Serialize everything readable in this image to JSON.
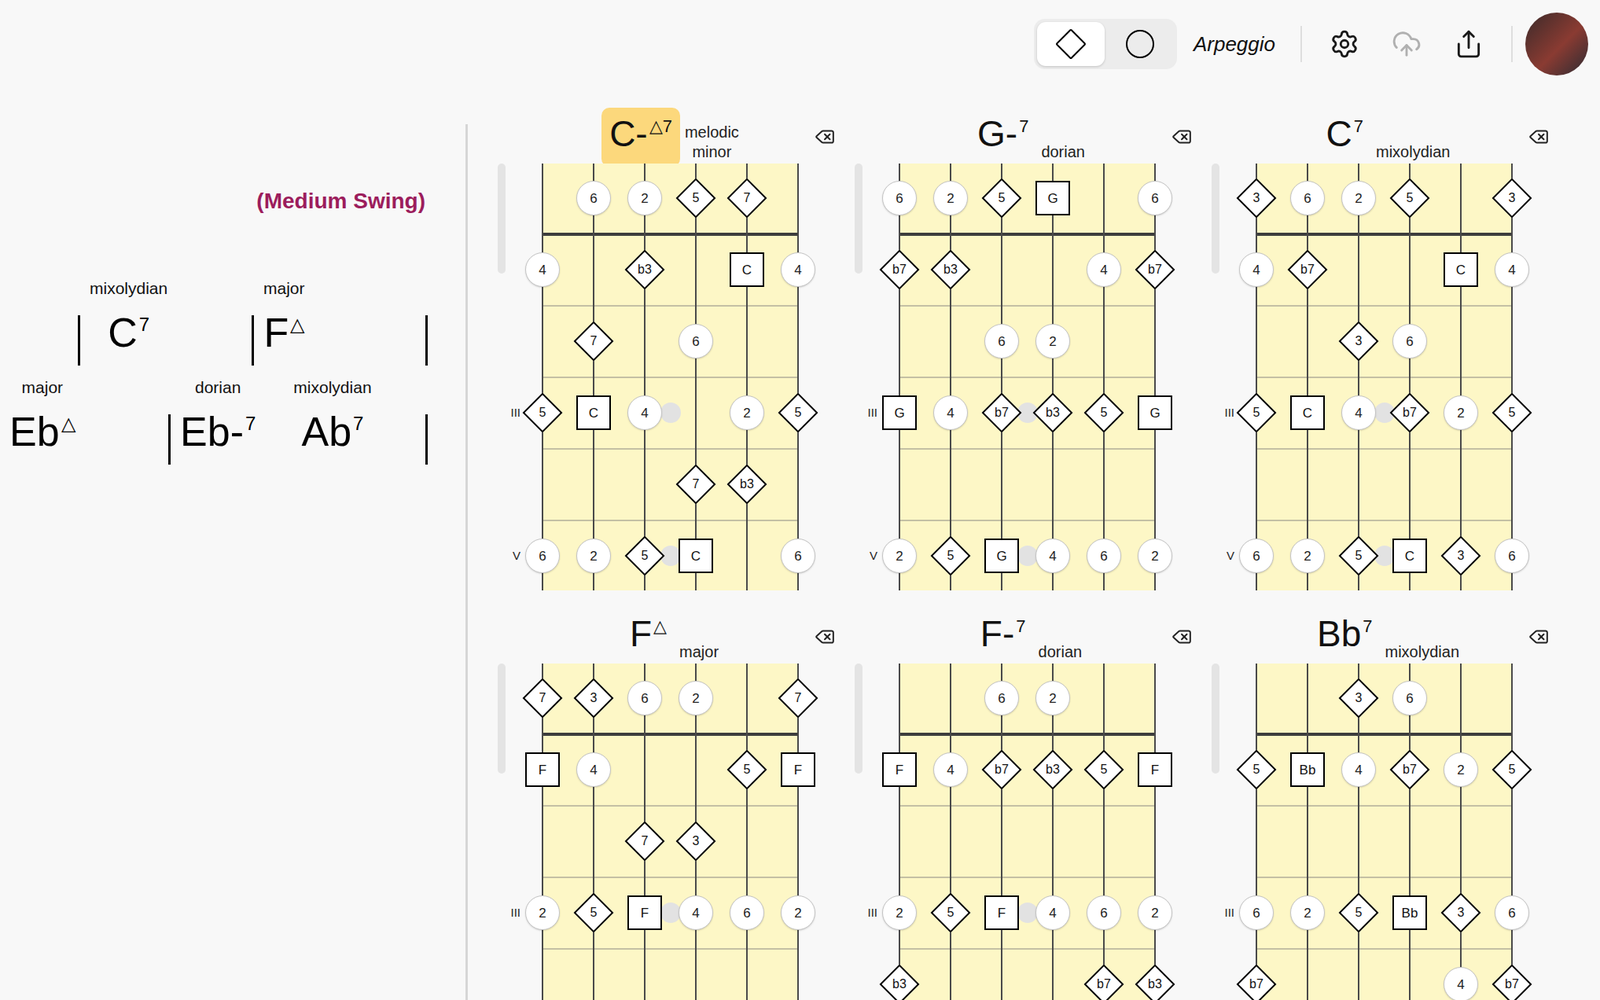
{
  "toolbar": {
    "shape_toggle": [
      {
        "kind": "diamond",
        "selected": true
      },
      {
        "kind": "circle",
        "selected": false
      }
    ],
    "mode": "Arpeggio",
    "buttons": [
      {
        "kind": "settings",
        "disabled": false
      },
      {
        "kind": "upload",
        "disabled": true
      },
      {
        "kind": "share",
        "disabled": false
      }
    ]
  },
  "chart": {
    "style": "(Medium Swing)",
    "rows": [
      {
        "barline_start": true,
        "measures": [
          {
            "chords": [
              {
                "scale": "mixolydian",
                "root": "C",
                "quality": "",
                "ext": "7"
              }
            ]
          },
          {
            "chords": [
              {
                "scale": "major",
                "root": "F",
                "quality": "",
                "ext": "△"
              }
            ]
          }
        ]
      },
      {
        "barline_start": false,
        "measures": [
          {
            "chords": [
              {
                "scale": "major",
                "root": "Eb",
                "quality": "",
                "ext": "△"
              }
            ]
          },
          {
            "chords": [
              {
                "scale": "dorian",
                "root": "Eb",
                "quality": "-",
                "ext": "7"
              },
              {
                "scale": "mixolydian",
                "root": "Ab",
                "quality": "",
                "ext": "7"
              }
            ]
          }
        ]
      }
    ]
  },
  "diagrams": [
    {
      "chord": {
        "root": "C",
        "quality": "-",
        "ext": "△7"
      },
      "scale": "melodic minor",
      "selected": true,
      "fret_labels": [
        {
          "row": 3,
          "text": "III"
        },
        {
          "row": 5,
          "text": "V"
        }
      ],
      "slides": [
        {
          "string": 2,
          "row": 3
        },
        {
          "string": 2,
          "row": 5
        }
      ],
      "markers": [
        {
          "string": 1,
          "row": 0,
          "kind": "circle",
          "label": "6"
        },
        {
          "string": 2,
          "row": 0,
          "kind": "circle",
          "label": "2"
        },
        {
          "string": 3,
          "row": 0,
          "kind": "diamond",
          "label": "5"
        },
        {
          "string": 4,
          "row": 0,
          "kind": "diamond",
          "label": "7"
        },
        {
          "string": 0,
          "row": 1,
          "kind": "circle",
          "label": "4"
        },
        {
          "string": 2,
          "row": 1,
          "kind": "diamond",
          "label": "b3"
        },
        {
          "string": 4,
          "row": 1,
          "kind": "square",
          "label": "C"
        },
        {
          "string": 5,
          "row": 1,
          "kind": "circle",
          "label": "4"
        },
        {
          "string": 1,
          "row": 2,
          "kind": "diamond",
          "label": "7"
        },
        {
          "string": 3,
          "row": 2,
          "kind": "circle",
          "label": "6"
        },
        {
          "string": 0,
          "row": 3,
          "kind": "diamond",
          "label": "5"
        },
        {
          "string": 1,
          "row": 3,
          "kind": "square",
          "label": "C"
        },
        {
          "string": 2,
          "row": 3,
          "kind": "circle",
          "label": "4"
        },
        {
          "string": 4,
          "row": 3,
          "kind": "circle",
          "label": "2"
        },
        {
          "string": 5,
          "row": 3,
          "kind": "diamond",
          "label": "5"
        },
        {
          "string": 3,
          "row": 4,
          "kind": "diamond",
          "label": "7"
        },
        {
          "string": 4,
          "row": 4,
          "kind": "diamond",
          "label": "b3"
        },
        {
          "string": 0,
          "row": 5,
          "kind": "circle",
          "label": "6"
        },
        {
          "string": 1,
          "row": 5,
          "kind": "circle",
          "label": "2"
        },
        {
          "string": 2,
          "row": 5,
          "kind": "diamond",
          "label": "5"
        },
        {
          "string": 3,
          "row": 5,
          "kind": "square",
          "label": "C"
        },
        {
          "string": 5,
          "row": 5,
          "kind": "circle",
          "label": "6"
        }
      ]
    },
    {
      "chord": {
        "root": "G",
        "quality": "-",
        "ext": "7"
      },
      "scale": "dorian",
      "selected": false,
      "fret_labels": [
        {
          "row": 3,
          "text": "III"
        },
        {
          "row": 5,
          "text": "V"
        }
      ],
      "slides": [
        {
          "string": 2,
          "row": 3
        },
        {
          "string": 2,
          "row": 5
        }
      ],
      "markers": [
        {
          "string": 0,
          "row": 0,
          "kind": "circle",
          "label": "6"
        },
        {
          "string": 1,
          "row": 0,
          "kind": "circle",
          "label": "2"
        },
        {
          "string": 2,
          "row": 0,
          "kind": "diamond",
          "label": "5"
        },
        {
          "string": 3,
          "row": 0,
          "kind": "square",
          "label": "G"
        },
        {
          "string": 5,
          "row": 0,
          "kind": "circle",
          "label": "6"
        },
        {
          "string": 0,
          "row": 1,
          "kind": "diamond",
          "label": "b7"
        },
        {
          "string": 1,
          "row": 1,
          "kind": "diamond",
          "label": "b3"
        },
        {
          "string": 4,
          "row": 1,
          "kind": "circle",
          "label": "4"
        },
        {
          "string": 5,
          "row": 1,
          "kind": "diamond",
          "label": "b7"
        },
        {
          "string": 2,
          "row": 2,
          "kind": "circle",
          "label": "6"
        },
        {
          "string": 3,
          "row": 2,
          "kind": "circle",
          "label": "2"
        },
        {
          "string": 0,
          "row": 3,
          "kind": "square",
          "label": "G"
        },
        {
          "string": 1,
          "row": 3,
          "kind": "circle",
          "label": "4"
        },
        {
          "string": 2,
          "row": 3,
          "kind": "diamond",
          "label": "b7"
        },
        {
          "string": 3,
          "row": 3,
          "kind": "diamond",
          "label": "b3"
        },
        {
          "string": 4,
          "row": 3,
          "kind": "diamond",
          "label": "5"
        },
        {
          "string": 5,
          "row": 3,
          "kind": "square",
          "label": "G"
        },
        {
          "string": 0,
          "row": 5,
          "kind": "circle",
          "label": "2"
        },
        {
          "string": 1,
          "row": 5,
          "kind": "diamond",
          "label": "5"
        },
        {
          "string": 2,
          "row": 5,
          "kind": "square",
          "label": "G"
        },
        {
          "string": 3,
          "row": 5,
          "kind": "circle",
          "label": "4"
        },
        {
          "string": 4,
          "row": 5,
          "kind": "circle",
          "label": "6"
        },
        {
          "string": 5,
          "row": 5,
          "kind": "circle",
          "label": "2"
        }
      ]
    },
    {
      "chord": {
        "root": "C",
        "quality": "",
        "ext": "7"
      },
      "scale": "mixolydian",
      "selected": false,
      "fret_labels": [
        {
          "row": 3,
          "text": "III"
        },
        {
          "row": 5,
          "text": "V"
        }
      ],
      "slides": [
        {
          "string": 2,
          "row": 3
        },
        {
          "string": 2,
          "row": 5
        }
      ],
      "markers": [
        {
          "string": 0,
          "row": 0,
          "kind": "diamond",
          "label": "3"
        },
        {
          "string": 1,
          "row": 0,
          "kind": "circle",
          "label": "6"
        },
        {
          "string": 2,
          "row": 0,
          "kind": "circle",
          "label": "2"
        },
        {
          "string": 3,
          "row": 0,
          "kind": "diamond",
          "label": "5"
        },
        {
          "string": 5,
          "row": 0,
          "kind": "diamond",
          "label": "3"
        },
        {
          "string": 0,
          "row": 1,
          "kind": "circle",
          "label": "4"
        },
        {
          "string": 1,
          "row": 1,
          "kind": "diamond",
          "label": "b7"
        },
        {
          "string": 4,
          "row": 1,
          "kind": "square",
          "label": "C"
        },
        {
          "string": 5,
          "row": 1,
          "kind": "circle",
          "label": "4"
        },
        {
          "string": 2,
          "row": 2,
          "kind": "diamond",
          "label": "3"
        },
        {
          "string": 3,
          "row": 2,
          "kind": "circle",
          "label": "6"
        },
        {
          "string": 0,
          "row": 3,
          "kind": "diamond",
          "label": "5"
        },
        {
          "string": 1,
          "row": 3,
          "kind": "square",
          "label": "C"
        },
        {
          "string": 2,
          "row": 3,
          "kind": "circle",
          "label": "4"
        },
        {
          "string": 3,
          "row": 3,
          "kind": "diamond",
          "label": "b7"
        },
        {
          "string": 4,
          "row": 3,
          "kind": "circle",
          "label": "2"
        },
        {
          "string": 5,
          "row": 3,
          "kind": "diamond",
          "label": "5"
        },
        {
          "string": 0,
          "row": 5,
          "kind": "circle",
          "label": "6"
        },
        {
          "string": 1,
          "row": 5,
          "kind": "circle",
          "label": "2"
        },
        {
          "string": 2,
          "row": 5,
          "kind": "diamond",
          "label": "5"
        },
        {
          "string": 3,
          "row": 5,
          "kind": "square",
          "label": "C"
        },
        {
          "string": 4,
          "row": 5,
          "kind": "diamond",
          "label": "3"
        },
        {
          "string": 5,
          "row": 5,
          "kind": "circle",
          "label": "6"
        }
      ]
    },
    {
      "chord": {
        "root": "F",
        "quality": "",
        "ext": "△"
      },
      "scale": "major",
      "selected": false,
      "fret_labels": [
        {
          "row": 3,
          "text": "III"
        }
      ],
      "slides": [
        {
          "string": 2,
          "row": 3
        }
      ],
      "markers": [
        {
          "string": 0,
          "row": 0,
          "kind": "diamond",
          "label": "7"
        },
        {
          "string": 1,
          "row": 0,
          "kind": "diamond",
          "label": "3"
        },
        {
          "string": 2,
          "row": 0,
          "kind": "circle",
          "label": "6"
        },
        {
          "string": 3,
          "row": 0,
          "kind": "circle",
          "label": "2"
        },
        {
          "string": 5,
          "row": 0,
          "kind": "diamond",
          "label": "7"
        },
        {
          "string": 0,
          "row": 1,
          "kind": "square",
          "label": "F"
        },
        {
          "string": 1,
          "row": 1,
          "kind": "circle",
          "label": "4"
        },
        {
          "string": 4,
          "row": 1,
          "kind": "diamond",
          "label": "5"
        },
        {
          "string": 5,
          "row": 1,
          "kind": "square",
          "label": "F"
        },
        {
          "string": 2,
          "row": 2,
          "kind": "diamond",
          "label": "7"
        },
        {
          "string": 3,
          "row": 2,
          "kind": "diamond",
          "label": "3"
        },
        {
          "string": 0,
          "row": 3,
          "kind": "circle",
          "label": "2"
        },
        {
          "string": 1,
          "row": 3,
          "kind": "diamond",
          "label": "5"
        },
        {
          "string": 2,
          "row": 3,
          "kind": "square",
          "label": "F"
        },
        {
          "string": 3,
          "row": 3,
          "kind": "circle",
          "label": "4"
        },
        {
          "string": 4,
          "row": 3,
          "kind": "circle",
          "label": "6"
        },
        {
          "string": 5,
          "row": 3,
          "kind": "circle",
          "label": "2"
        }
      ]
    },
    {
      "chord": {
        "root": "F",
        "quality": "-",
        "ext": "7"
      },
      "scale": "dorian",
      "selected": false,
      "fret_labels": [
        {
          "row": 3,
          "text": "III"
        }
      ],
      "slides": [
        {
          "string": 2,
          "row": 3
        }
      ],
      "markers": [
        {
          "string": 2,
          "row": 0,
          "kind": "circle",
          "label": "6"
        },
        {
          "string": 3,
          "row": 0,
          "kind": "circle",
          "label": "2"
        },
        {
          "string": 0,
          "row": 1,
          "kind": "square",
          "label": "F"
        },
        {
          "string": 1,
          "row": 1,
          "kind": "circle",
          "label": "4"
        },
        {
          "string": 2,
          "row": 1,
          "kind": "diamond",
          "label": "b7"
        },
        {
          "string": 3,
          "row": 1,
          "kind": "diamond",
          "label": "b3"
        },
        {
          "string": 4,
          "row": 1,
          "kind": "diamond",
          "label": "5"
        },
        {
          "string": 5,
          "row": 1,
          "kind": "square",
          "label": "F"
        },
        {
          "string": 0,
          "row": 3,
          "kind": "circle",
          "label": "2"
        },
        {
          "string": 1,
          "row": 3,
          "kind": "diamond",
          "label": "5"
        },
        {
          "string": 2,
          "row": 3,
          "kind": "square",
          "label": "F"
        },
        {
          "string": 3,
          "row": 3,
          "kind": "circle",
          "label": "4"
        },
        {
          "string": 4,
          "row": 3,
          "kind": "circle",
          "label": "6"
        },
        {
          "string": 5,
          "row": 3,
          "kind": "circle",
          "label": "2"
        },
        {
          "string": 0,
          "row": 4,
          "kind": "diamond",
          "label": "b3"
        },
        {
          "string": 4,
          "row": 4,
          "kind": "diamond",
          "label": "b7"
        },
        {
          "string": 5,
          "row": 4,
          "kind": "diamond",
          "label": "b3"
        }
      ]
    },
    {
      "chord": {
        "root": "Bb",
        "quality": "",
        "ext": "7"
      },
      "scale": "mixolydian",
      "selected": false,
      "fret_labels": [
        {
          "row": 3,
          "text": "III"
        }
      ],
      "slides": [],
      "markers": [
        {
          "string": 2,
          "row": 0,
          "kind": "diamond",
          "label": "3"
        },
        {
          "string": 3,
          "row": 0,
          "kind": "circle",
          "label": "6"
        },
        {
          "string": 0,
          "row": 1,
          "kind": "diamond",
          "label": "5"
        },
        {
          "string": 1,
          "row": 1,
          "kind": "square",
          "label": "Bb"
        },
        {
          "string": 2,
          "row": 1,
          "kind": "circle",
          "label": "4"
        },
        {
          "string": 3,
          "row": 1,
          "kind": "diamond",
          "label": "b7"
        },
        {
          "string": 4,
          "row": 1,
          "kind": "circle",
          "label": "2"
        },
        {
          "string": 5,
          "row": 1,
          "kind": "diamond",
          "label": "5"
        },
        {
          "string": 0,
          "row": 3,
          "kind": "circle",
          "label": "6"
        },
        {
          "string": 1,
          "row": 3,
          "kind": "circle",
          "label": "2"
        },
        {
          "string": 2,
          "row": 3,
          "kind": "diamond",
          "label": "5"
        },
        {
          "string": 3,
          "row": 3,
          "kind": "square",
          "label": "Bb"
        },
        {
          "string": 4,
          "row": 3,
          "kind": "diamond",
          "label": "3"
        },
        {
          "string": 5,
          "row": 3,
          "kind": "circle",
          "label": "6"
        },
        {
          "string": 0,
          "row": 4,
          "kind": "diamond",
          "label": "b7"
        },
        {
          "string": 4,
          "row": 4,
          "kind": "circle",
          "label": "4"
        },
        {
          "string": 5,
          "row": 4,
          "kind": "diamond",
          "label": "b7"
        }
      ]
    }
  ]
}
